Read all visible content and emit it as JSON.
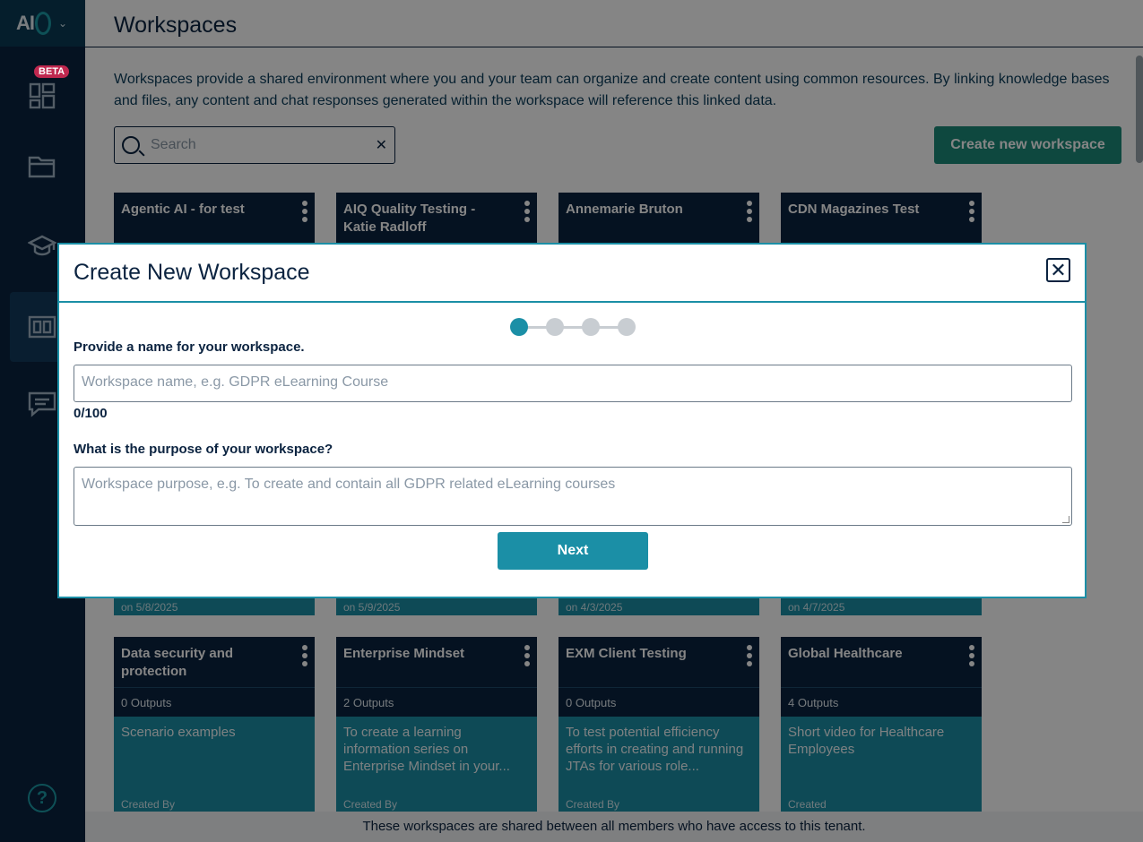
{
  "sidebar": {
    "logo_text": "AI",
    "beta_badge": "BETA",
    "help_label": "?",
    "items": [
      {
        "icon": "dashboard-icon"
      },
      {
        "icon": "folder-icon"
      },
      {
        "icon": "graduation-cap-icon"
      },
      {
        "icon": "workspaces-icon",
        "active": true
      },
      {
        "icon": "chat-icon"
      }
    ]
  },
  "page": {
    "title": "Workspaces",
    "description": "Workspaces provide a shared environment where you and your team can organize and create content using common resources. By linking knowledge bases and files, any content and chat responses generated within the workspace will reference this linked data.",
    "search_placeholder": "Search",
    "search_clear": "✕",
    "create_button": "Create new workspace",
    "footer": "These workspaces are shared between all members who have access to this tenant."
  },
  "cards_row1": [
    {
      "title": "Agentic AI - for test",
      "date": "on 5/8/2025"
    },
    {
      "title": "AIQ Quality Testing - Katie Radloff",
      "date": "on 5/9/2025"
    },
    {
      "title": "Annemarie Bruton",
      "date": "on 4/3/2025"
    },
    {
      "title": "CDN Magazines Test",
      "date": "on 4/7/2025"
    }
  ],
  "cards_row2": [
    {
      "title": "Data security and protection",
      "outputs": "0 Outputs",
      "description": "Scenario examples",
      "created": "Created By"
    },
    {
      "title": "Enterprise Mindset",
      "outputs": "2 Outputs",
      "description": "To create a learning information series on Enterprise Mindset in your...",
      "created": "Created By"
    },
    {
      "title": "EXM Client Testing",
      "outputs": "0 Outputs",
      "description": "To test potential efficiency efforts in creating and running JTAs for various role...",
      "created": "Created By"
    },
    {
      "title": "Global Healthcare",
      "outputs": "4 Outputs",
      "description": "Short video for Healthcare Employees",
      "created": "Created"
    }
  ],
  "modal": {
    "title": "Create New Workspace",
    "close": "✕",
    "steps_total": 4,
    "current_step": 1,
    "name_label": "Provide a name for your workspace.",
    "name_placeholder": "Workspace name, e.g. GDPR eLearning Course",
    "name_counter": "0/100",
    "purpose_label": "What is the purpose of your workspace?",
    "purpose_placeholder": "Workspace purpose, e.g. To create and contain all GDPR related eLearning courses",
    "next_button": "Next"
  },
  "colors": {
    "navy": "#0b2340",
    "teal": "#1b8fa6",
    "green": "#1b8a7a",
    "beta": "#c0284f"
  }
}
